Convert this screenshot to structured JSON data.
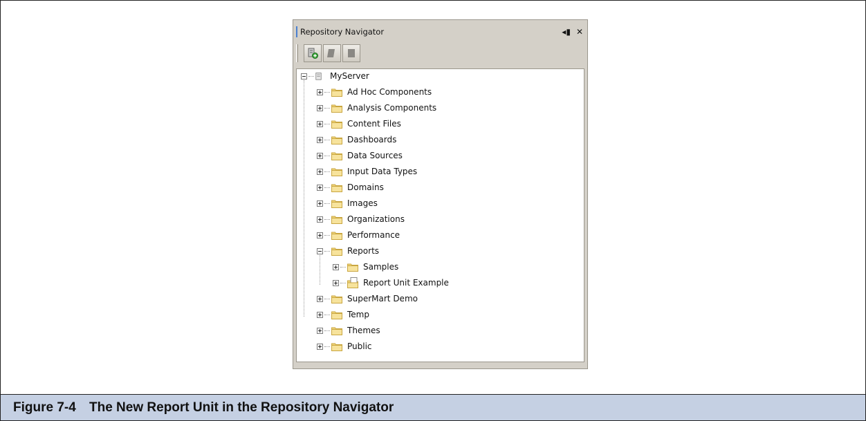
{
  "panel": {
    "title": "Repository Navigator",
    "pin_glyph": "◂▮",
    "close_glyph": "✕"
  },
  "toolbar": {
    "buttons": [
      {
        "icon": "add-repository-icon"
      },
      {
        "icon": "disabled-action-icon"
      },
      {
        "icon": "disabled-action-icon"
      }
    ]
  },
  "tree": {
    "root": "MyServer",
    "items": [
      {
        "label": "Ad Hoc Components",
        "expanded": false
      },
      {
        "label": "Analysis Components",
        "expanded": false
      },
      {
        "label": "Content Files",
        "expanded": false
      },
      {
        "label": "Dashboards",
        "expanded": false
      },
      {
        "label": "Data Sources",
        "expanded": false
      },
      {
        "label": "Input Data Types",
        "expanded": false
      },
      {
        "label": "Domains",
        "expanded": false
      },
      {
        "label": "Images",
        "expanded": false
      },
      {
        "label": "Organizations",
        "expanded": false
      },
      {
        "label": "Performance",
        "expanded": false
      },
      {
        "label": "Reports",
        "expanded": true,
        "children": [
          {
            "label": "Samples",
            "icon": "folder-icon"
          },
          {
            "label": "Report Unit Example",
            "icon": "report-unit-icon"
          }
        ]
      },
      {
        "label": "SuperMart Demo",
        "expanded": false
      },
      {
        "label": "Temp",
        "expanded": false
      },
      {
        "label": "Themes",
        "expanded": false
      },
      {
        "label": "Public",
        "expanded": false
      }
    ]
  },
  "caption": {
    "number": "Figure 7-4",
    "text": "The New Report Unit in the Repository Navigator"
  },
  "colors": {
    "caption_bg": "#c5d0e3",
    "panel_bg": "#d4d0c8",
    "folder": "#f1d57a"
  }
}
